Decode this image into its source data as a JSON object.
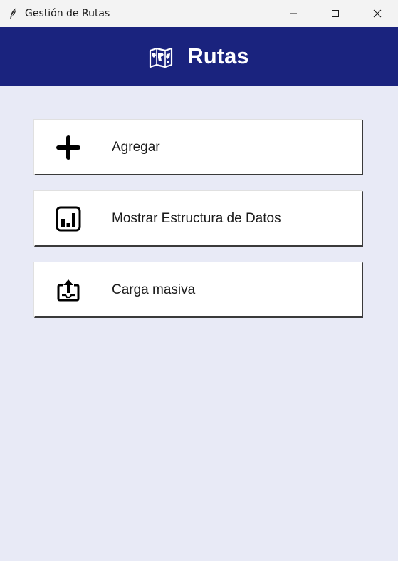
{
  "window": {
    "title": "Gestión de Rutas"
  },
  "header": {
    "title": "Rutas",
    "icon": "world-map-icon",
    "background": "#1a237e"
  },
  "menu": [
    {
      "label": "Agregar",
      "icon": "plus-icon"
    },
    {
      "label": "Mostrar Estructura de Datos",
      "icon": "bar-chart-icon"
    },
    {
      "label": "Carga masiva",
      "icon": "upload-icon"
    }
  ],
  "colors": {
    "background": "#e8eaf6",
    "button_background": "#ffffff",
    "header_text": "#ffffff"
  }
}
